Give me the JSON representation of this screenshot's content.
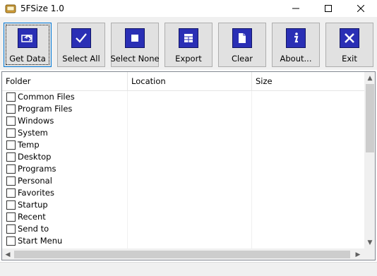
{
  "window": {
    "title": "5FSize 1.0"
  },
  "toolbar": {
    "buttons": [
      {
        "label": "Get Data",
        "icon": "get-data-icon"
      },
      {
        "label": "Select All",
        "icon": "checkmark-icon"
      },
      {
        "label": "Select None",
        "icon": "square-icon"
      },
      {
        "label": "Export",
        "icon": "export-icon"
      },
      {
        "label": "Clear",
        "icon": "document-icon"
      },
      {
        "label": "About...",
        "icon": "info-icon"
      },
      {
        "label": "Exit",
        "icon": "close-x-icon"
      }
    ]
  },
  "table": {
    "columns": [
      "Folder",
      "Location",
      "Size"
    ],
    "rows": [
      "Common Files",
      "Program Files",
      "Windows",
      "System",
      "Temp",
      "Desktop",
      "Programs",
      "Personal",
      "Favorites",
      "Startup",
      "Recent",
      "Send to",
      "Start Menu"
    ]
  },
  "colors": {
    "icon_blue": "#2a2fb5",
    "focus_border": "#0078d7",
    "toolbar_bg": "#f0f0f0"
  }
}
